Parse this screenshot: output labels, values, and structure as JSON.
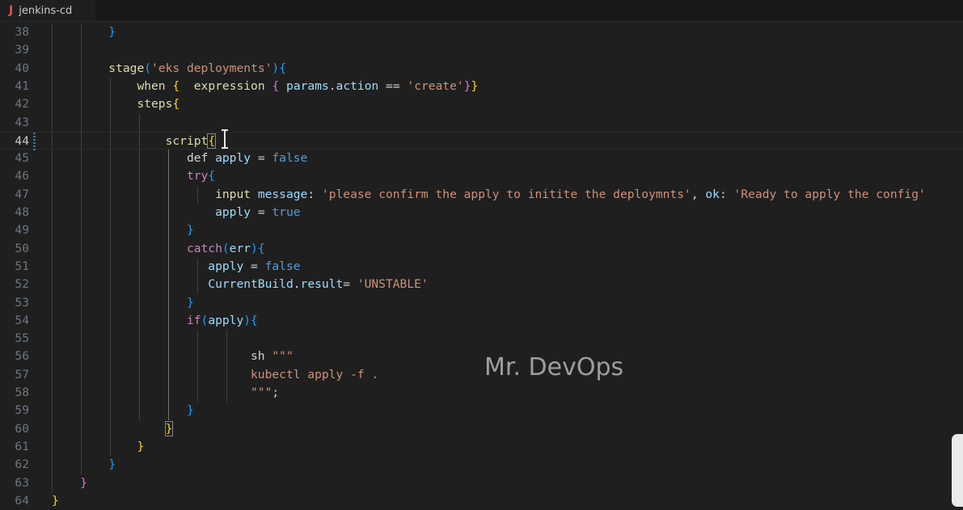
{
  "tab": {
    "icon": "J",
    "title": "jenkins-cd"
  },
  "watermark": "Mr. DevOps",
  "current_line": "44",
  "colors": {
    "background": "#1f1f1f",
    "plain": "#d4d4d4",
    "keyword": "#c586c0",
    "string": "#ce9178",
    "function": "#dcdcaa",
    "variable": "#9cdcfe",
    "boolean": "#569cd6",
    "bracket_gold": "#ffd700",
    "bracket_orchid": "#da70d6",
    "bracket_blue": "#179fff"
  },
  "lines": [
    {
      "num": "38",
      "tokens": [
        [
          "        ",
          "plain"
        ],
        [
          "}",
          "b3"
        ]
      ]
    },
    {
      "num": "39",
      "tokens": []
    },
    {
      "num": "40",
      "tokens": [
        [
          "        ",
          "plain"
        ],
        [
          "stage",
          "func"
        ],
        [
          "(",
          "b3"
        ],
        [
          "'eks deployments'",
          "str"
        ],
        [
          ")",
          "b3"
        ],
        [
          "{",
          "b3"
        ]
      ]
    },
    {
      "num": "41",
      "tokens": [
        [
          "            ",
          "plain"
        ],
        [
          "when",
          "func"
        ],
        [
          " ",
          "plain"
        ],
        [
          "{",
          "b1"
        ],
        [
          "  ",
          "plain"
        ],
        [
          "expression",
          "func"
        ],
        [
          " ",
          "plain"
        ],
        [
          "{",
          "b2"
        ],
        [
          " ",
          "plain"
        ],
        [
          "params",
          "var"
        ],
        [
          ".",
          "plain"
        ],
        [
          "action",
          "var"
        ],
        [
          " == ",
          "plain"
        ],
        [
          "'create'",
          "str"
        ],
        [
          "}",
          "b2"
        ],
        [
          "}",
          "b1"
        ]
      ]
    },
    {
      "num": "42",
      "tokens": [
        [
          "            ",
          "plain"
        ],
        [
          "steps",
          "func"
        ],
        [
          "{",
          "b1"
        ]
      ]
    },
    {
      "num": "43",
      "tokens": []
    },
    {
      "num": "44",
      "tokens": [
        [
          "                ",
          "plain"
        ],
        [
          "script",
          "func"
        ],
        [
          "{",
          "bmatch"
        ]
      ]
    },
    {
      "num": "45",
      "tokens": [
        [
          "                   ",
          "plain"
        ],
        [
          "def",
          "plain"
        ],
        [
          " ",
          "plain"
        ],
        [
          "apply",
          "var"
        ],
        [
          " = ",
          "plain"
        ],
        [
          "false",
          "bool"
        ]
      ]
    },
    {
      "num": "46",
      "tokens": [
        [
          "                   ",
          "plain"
        ],
        [
          "try",
          "keyword"
        ],
        [
          "{",
          "b3"
        ]
      ]
    },
    {
      "num": "47",
      "tokens": [
        [
          "                       ",
          "plain"
        ],
        [
          "input",
          "func"
        ],
        [
          " ",
          "plain"
        ],
        [
          "message",
          "var"
        ],
        [
          ": ",
          "plain"
        ],
        [
          "'please confirm the apply to initite the deploymnts'",
          "str"
        ],
        [
          ", ",
          "plain"
        ],
        [
          "ok",
          "var"
        ],
        [
          ": ",
          "plain"
        ],
        [
          "'Ready to apply the config'",
          "str"
        ]
      ]
    },
    {
      "num": "48",
      "tokens": [
        [
          "                       ",
          "plain"
        ],
        [
          "apply",
          "var"
        ],
        [
          " = ",
          "plain"
        ],
        [
          "true",
          "bool"
        ]
      ]
    },
    {
      "num": "49",
      "tokens": [
        [
          "                   ",
          "plain"
        ],
        [
          "}",
          "b3"
        ]
      ]
    },
    {
      "num": "50",
      "tokens": [
        [
          "                   ",
          "plain"
        ],
        [
          "catch",
          "keyword"
        ],
        [
          "(",
          "b3"
        ],
        [
          "err",
          "var"
        ],
        [
          ")",
          "b3"
        ],
        [
          "{",
          "b3"
        ]
      ]
    },
    {
      "num": "51",
      "tokens": [
        [
          "                      ",
          "plain"
        ],
        [
          "apply",
          "var"
        ],
        [
          " = ",
          "plain"
        ],
        [
          "false",
          "bool"
        ]
      ]
    },
    {
      "num": "52",
      "tokens": [
        [
          "                      ",
          "plain"
        ],
        [
          "CurrentBuild",
          "var"
        ],
        [
          ".",
          "plain"
        ],
        [
          "result",
          "var"
        ],
        [
          "= ",
          "plain"
        ],
        [
          "'UNSTABLE'",
          "str"
        ]
      ]
    },
    {
      "num": "53",
      "tokens": [
        [
          "                   ",
          "plain"
        ],
        [
          "}",
          "b3"
        ]
      ]
    },
    {
      "num": "54",
      "tokens": [
        [
          "                   ",
          "plain"
        ],
        [
          "if",
          "keyword"
        ],
        [
          "(",
          "b3"
        ],
        [
          "apply",
          "var"
        ],
        [
          ")",
          "b3"
        ],
        [
          "{",
          "b3"
        ]
      ]
    },
    {
      "num": "55",
      "tokens": []
    },
    {
      "num": "56",
      "tokens": [
        [
          "                            ",
          "plain"
        ],
        [
          "sh ",
          "plain"
        ],
        [
          "\"\"\"",
          "str"
        ]
      ]
    },
    {
      "num": "57",
      "tokens": [
        [
          "                            ",
          "plain"
        ],
        [
          "kubectl apply -f .",
          "str"
        ]
      ]
    },
    {
      "num": "58",
      "tokens": [
        [
          "                            ",
          "plain"
        ],
        [
          "\"\"\"",
          "str"
        ],
        [
          ";",
          "plain"
        ]
      ]
    },
    {
      "num": "59",
      "tokens": [
        [
          "                   ",
          "plain"
        ],
        [
          "}",
          "b3"
        ]
      ]
    },
    {
      "num": "60",
      "tokens": [
        [
          "                ",
          "plain"
        ],
        [
          "}",
          "bmatch"
        ]
      ]
    },
    {
      "num": "61",
      "tokens": [
        [
          "            ",
          "plain"
        ],
        [
          "}",
          "b1"
        ]
      ]
    },
    {
      "num": "62",
      "tokens": [
        [
          "        ",
          "plain"
        ],
        [
          "}",
          "b3"
        ]
      ]
    },
    {
      "num": "63",
      "tokens": [
        [
          "    ",
          "plain"
        ],
        [
          "}",
          "b2"
        ]
      ]
    },
    {
      "num": "64",
      "tokens": [
        [
          "",
          "plain"
        ],
        [
          "}",
          "b1"
        ]
      ]
    }
  ]
}
